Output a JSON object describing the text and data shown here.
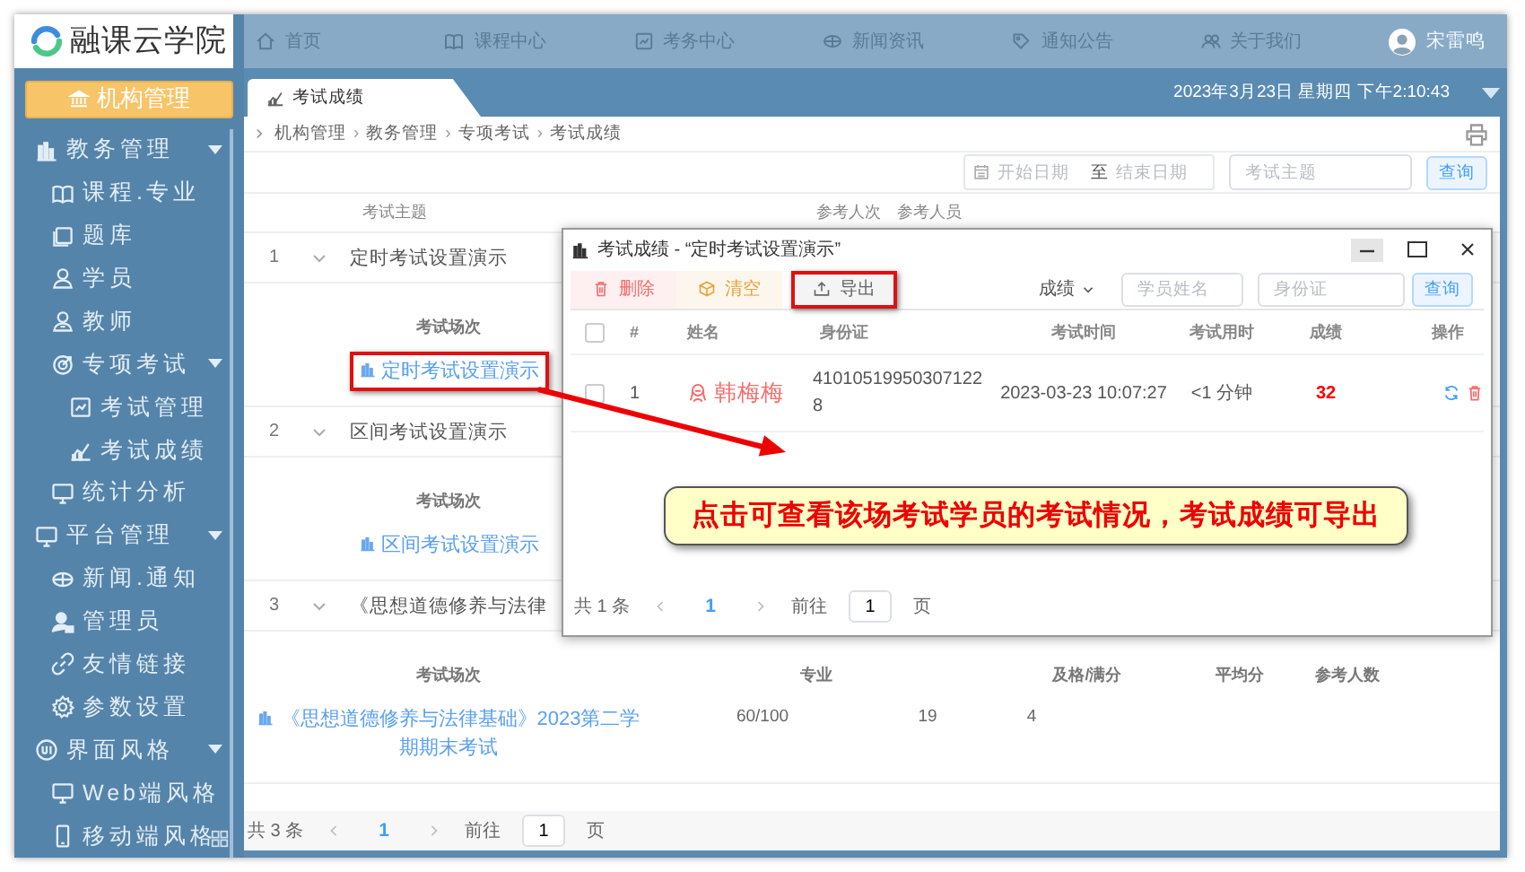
{
  "logo": {
    "text": "融课云学院"
  },
  "top_nav": {
    "items": [
      "首页",
      "课程中心",
      "考务中心",
      "新闻资讯",
      "通知公告",
      "关于我们"
    ],
    "user": "宋雷鸣"
  },
  "sidebar": {
    "org_button": "机构管理",
    "items": [
      {
        "label": "教务管理",
        "expanded": true,
        "children": [
          {
            "label": "课程.专业"
          },
          {
            "label": "题库"
          },
          {
            "label": "学员"
          },
          {
            "label": "教师"
          },
          {
            "label": "专项考试",
            "expanded": true,
            "children": [
              {
                "label": "考试管理"
              },
              {
                "label": "考试成绩"
              }
            ]
          },
          {
            "label": "统计分析"
          }
        ]
      },
      {
        "label": "平台管理",
        "expanded": true,
        "children": [
          {
            "label": "新闻.通知"
          },
          {
            "label": "管理员"
          },
          {
            "label": "友情链接"
          },
          {
            "label": "参数设置"
          }
        ]
      },
      {
        "label": "界面风格",
        "expanded": true,
        "children": [
          {
            "label": "Web端风格"
          },
          {
            "label": "移动端风格"
          }
        ]
      }
    ]
  },
  "tabs": [
    {
      "label": "考试成绩",
      "selected": true
    }
  ],
  "datetime": "2023年3月23日 星期四 下午2:10:43",
  "breadcrumb": [
    {
      "label": "机构管理"
    },
    {
      "separator": "›",
      "label": "教务管理"
    },
    {
      "separator": "›",
      "label": "专项考试"
    },
    {
      "separator": "›",
      "label": "考试成绩"
    }
  ],
  "filters": {
    "start_date": {
      "placeholder": "开始日期"
    },
    "separator": "至",
    "end_date": {
      "placeholder": "结束日期"
    },
    "topic": {
      "placeholder": "考试主题"
    },
    "query_button": "查询"
  },
  "table": {
    "columns": [
      "考试主题",
      "参考人次",
      "参考人员"
    ],
    "groups": [
      {
        "index": "1",
        "title": "定时考试设置演示",
        "expanded": true,
        "session_columns": [
          "考试场次"
        ],
        "sessions": [
          {
            "title": "定时考试设置演示",
            "highlighted": true
          }
        ]
      },
      {
        "index": "2",
        "title": "区间考试设置演示",
        "expanded": true,
        "session_columns": [
          "考试场次"
        ],
        "sessions": [
          {
            "title": "区间考试设置演示",
            "highlighted": false
          }
        ]
      },
      {
        "index": "3",
        "title": "《思想道德修养与法律",
        "expanded": true,
        "session_columns": [
          "考试场次",
          "专业",
          "及格/满分",
          "平均分",
          "参考人数"
        ],
        "sessions": [
          {
            "title": "《思想道德修养与法律基础》2023第二学期期末考试",
            "highlighted": false,
            "cells": [
              "60/100",
              "19",
              "4"
            ]
          }
        ]
      }
    ]
  },
  "pager": {
    "total": "共 3 条",
    "pages": [
      {
        "label": "1",
        "selected": true
      }
    ],
    "goto_label": "前往",
    "goto_value": "1",
    "unit": "页"
  },
  "dialog": {
    "title": "考试成绩 - “定时考试设置演示”",
    "toolbar": [
      {
        "label": "删除",
        "kind": "danger",
        "highlighted": false
      },
      {
        "label": "清空",
        "kind": "warning",
        "highlighted": false
      },
      {
        "label": "导出",
        "kind": "plain",
        "highlighted": true
      }
    ],
    "sort": "成绩",
    "name_field": {
      "placeholder": "学员姓名"
    },
    "id_field": {
      "placeholder": "身份证"
    },
    "query_button": "查询",
    "table": {
      "all_checked": false,
      "columns": [
        "#",
        "姓名",
        "身份证",
        "考试时间",
        "考试用时",
        "成绩",
        "操作"
      ],
      "rows": [
        {
          "checked": false,
          "index": "1",
          "name": "韩梅梅",
          "id_number": "410105199503071228",
          "time": "2023-03-23 10:07:27",
          "duration": "<1 分钟",
          "score": "32"
        }
      ]
    },
    "pager": {
      "total": "共 1 条",
      "pages": [
        {
          "label": "1",
          "selected": true
        }
      ],
      "goto_label": "前往",
      "goto_value": "1",
      "unit": "页"
    }
  },
  "callout": {
    "text": "点击可查看该场考试学员的考试情况，考试成绩可导出"
  }
}
